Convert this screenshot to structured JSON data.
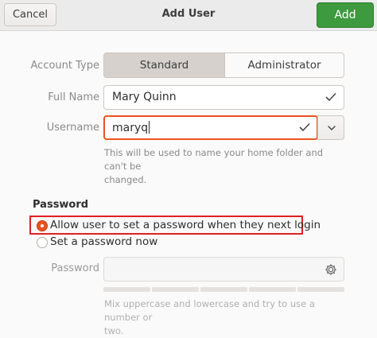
{
  "header": {
    "cancel_label": "Cancel",
    "title": "Add User",
    "add_label": "Add"
  },
  "account_type": {
    "label": "Account Type",
    "options": [
      "Standard",
      "Administrator"
    ],
    "selected": "Standard"
  },
  "full_name": {
    "label": "Full Name",
    "value": "Mary Quinn"
  },
  "username": {
    "label": "Username",
    "value": "maryq",
    "hint_line1": "This will be used to name your home folder and can't be",
    "hint_line2": "changed."
  },
  "password": {
    "section_title": "Password",
    "option_next_login": "Allow user to set a password when they next login",
    "option_now": "Set a password now",
    "selected": "Allow user to set a password when they next login",
    "field_label": "Password",
    "field_value": "",
    "hint_line1": "Mix uppercase and lowercase and try to use a number or",
    "hint_line2": "two."
  },
  "colors": {
    "accent": "#e95420",
    "add_button": "#3e9a3e",
    "highlight_box": "#e02020"
  },
  "icons": {
    "fullname_valid": "check-icon",
    "username_valid": "check-icon",
    "username_dropdown": "chevron-down-icon",
    "password_generate": "gear-icon"
  }
}
